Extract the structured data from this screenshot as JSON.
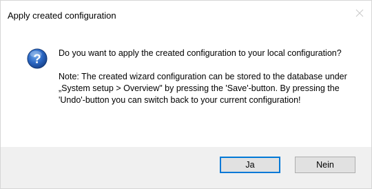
{
  "window": {
    "title": "Apply created configuration",
    "close_icon": "close-icon"
  },
  "message": {
    "icon": "question-icon",
    "question": "Do you want to apply the created configuration to your local configuration?",
    "note": "Note: The created wizard configuration can be stored to the database under „System setup > Overview\" by pressing the 'Save'-button. By pressing the 'Undo'-button you can switch back to your current configuration!"
  },
  "buttons": {
    "yes_label": "Ja",
    "no_label": "Nein"
  },
  "colors": {
    "icon_blue": "#1f5fb4",
    "focus_border": "#0078d7",
    "footer_bg": "#f0f0f0"
  }
}
